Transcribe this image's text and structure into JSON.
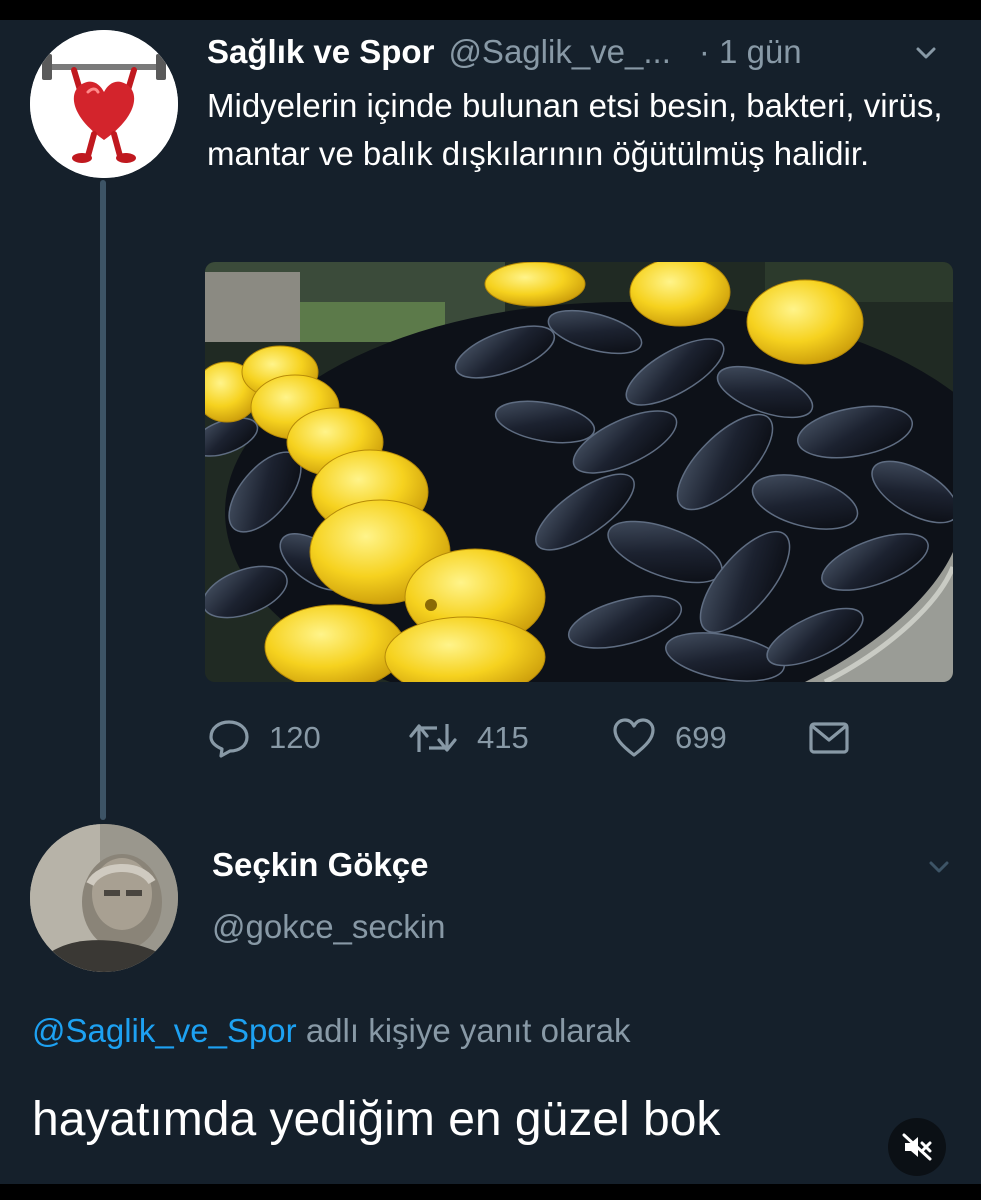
{
  "tweet": {
    "author_name": "Sağlık ve Spor",
    "author_handle": "@Saglik_ve_...",
    "time": "· 1 gün",
    "text": "Midyelerin içinde bulunan etsi besin, bakteri, virüs, mantar ve balık dışkılarının öğütülmüş halidir.",
    "stats": {
      "replies": "120",
      "retweets": "415",
      "likes": "699"
    },
    "icons": {
      "more": "chevron-down-icon",
      "reply": "speech-bubble-icon",
      "retweet": "retweet-icon",
      "like": "heart-icon",
      "dm": "envelope-icon"
    }
  },
  "reply": {
    "author_name": "Seçkin Gökçe",
    "author_handle": "@gokce_seckin",
    "reply_to_mention": "@Saglik_ve_Spor",
    "reply_to_suffix": " adlı kişiye yanıt olarak",
    "text": "hayatımda yediğim en güzel bok"
  },
  "overlay": {
    "mute_icon": "muted-speaker-icon"
  },
  "colors": {
    "background": "#15202b",
    "primary_text": "#ffffff",
    "secondary_text": "#8899a6",
    "link": "#1da1f2",
    "thread_line": "#3d5466"
  }
}
